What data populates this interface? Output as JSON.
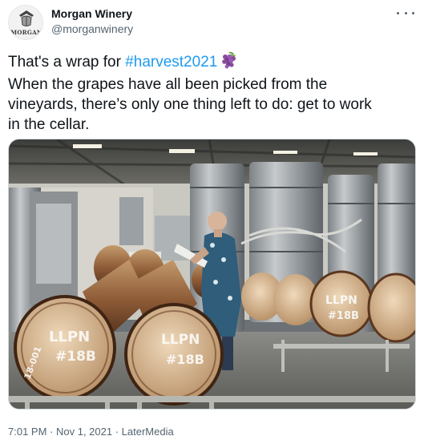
{
  "account": {
    "display_name": "Morgan Winery",
    "handle": "@morganwinery",
    "avatar_text": "MORGAN",
    "avatar_icon": "winery-crest-logo"
  },
  "more_icon": "more-horizontal-icon",
  "tweet": {
    "line1_prefix": "That's a wrap for ",
    "hashtag": "#harvest2021",
    "line1_emoji": "grapes",
    "line2": "When the grapes have all been picked from the",
    "line3": "vineyards, there’s only one thing left to do: get to work",
    "line4": "in the cellar."
  },
  "photo": {
    "subject": "winery-cellar-photo",
    "barrel_markings": [
      "LLPN",
      "#18B",
      "#18B",
      "18-001"
    ]
  },
  "footer": {
    "time": "7:01 PM",
    "date": "Nov 1, 2021",
    "source": "LaterMedia",
    "separator": " · "
  },
  "colors": {
    "text": "#0f1419",
    "secondary": "#536471",
    "link": "#1d9bf0"
  }
}
